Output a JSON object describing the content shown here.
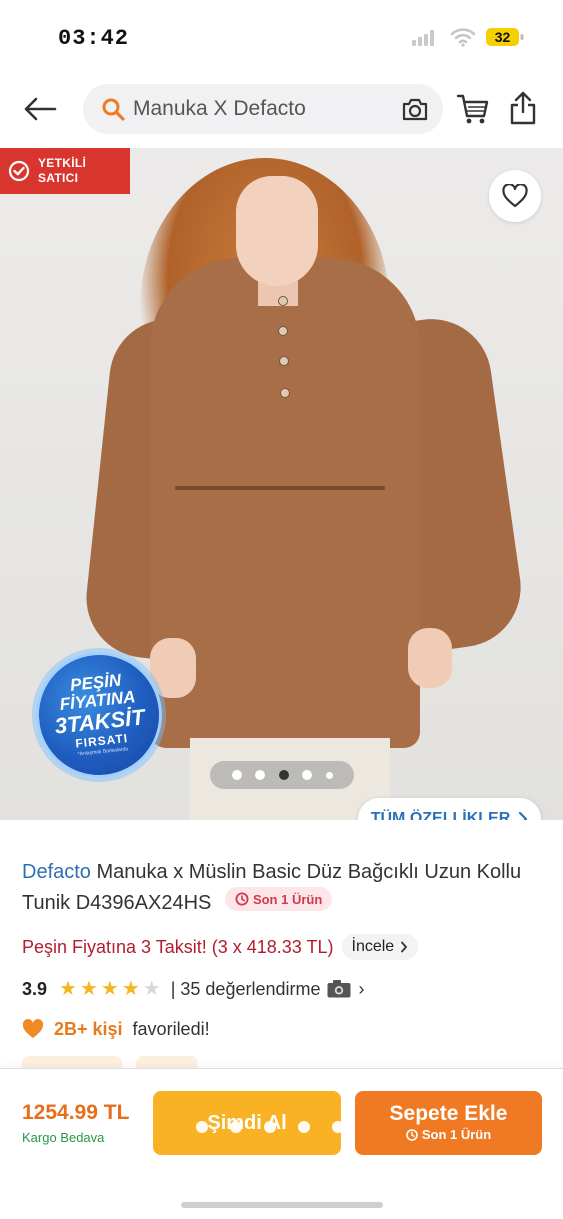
{
  "status_bar": {
    "time": "03:42",
    "battery_level": "32",
    "icons": [
      "signal-icon",
      "wifi-icon",
      "battery-icon"
    ]
  },
  "header": {
    "search_query": "Manuka X Defacto",
    "icons": [
      "back-arrow-icon",
      "search-icon",
      "camera-icon",
      "cart-icon",
      "share-icon"
    ]
  },
  "gallery": {
    "seller_badge": [
      "YETKİLİ",
      "SATICI"
    ],
    "promo": {
      "line1": "PEŞİN",
      "line2": "FİYATINA",
      "line3": "3TAKSİT",
      "line4": "FIRSATI",
      "fine_print": "*Anlaşmalı Bankalarda"
    },
    "image_count": 5,
    "active_index": 2,
    "all_features_label": "TÜM ÖZELLİKLER",
    "icons": [
      "heart-icon",
      "verified-icon",
      "chevron-right-icon"
    ]
  },
  "product": {
    "brand": "Defacto",
    "title": "Manuka x Müslin Basic Düz Bağcıklı Uzun Kollu Tunik D4396AX24HS",
    "stock_badge": "Son 1 Ürün",
    "installment_text": "Peşin Fiyatına 3 Taksit! (3 x 418.33 TL)",
    "inspect_label": "İncele",
    "rating": "3.9",
    "rating_value": 3.9,
    "stars_max": 5,
    "review_text": "| 35 değerlendirme",
    "favorite_count": "2B+ kişi",
    "favorite_text": "favoriledi!"
  },
  "bottom_bar": {
    "price": "1254.99 TL",
    "cargo": "Kargo Bedava",
    "buy_now": "Şimdi Al",
    "add_to_cart": "Sepete Ekle",
    "add_to_cart_sub": "Son 1 Ürün"
  },
  "colors": {
    "brand_blue": "#2f6fb4",
    "orange": "#f07a24",
    "yellow": "#f9b224",
    "red": "#d9352f",
    "green": "#239a45"
  }
}
